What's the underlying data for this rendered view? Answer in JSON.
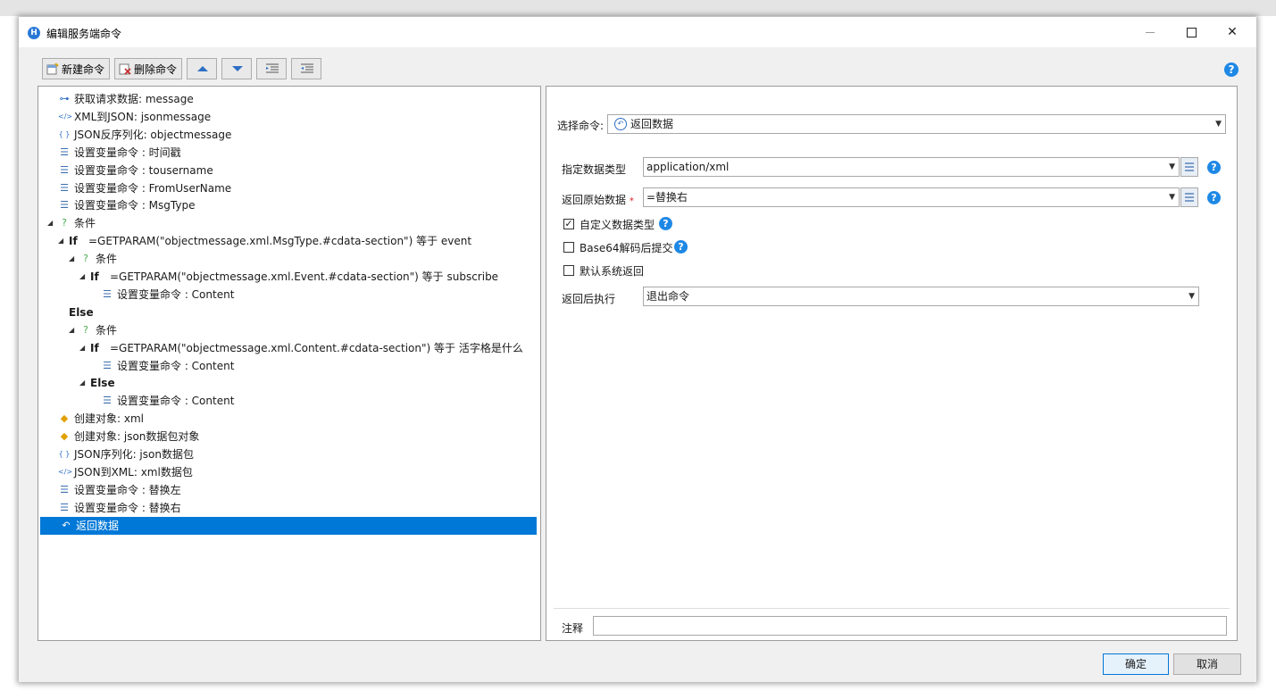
{
  "window": {
    "title": "编辑服务端命令",
    "app_icon": "H"
  },
  "toolbar": {
    "new_cmd": "新建命令",
    "delete_cmd": "删除命令"
  },
  "tree": [
    {
      "indent": 0,
      "icon": "request",
      "label": "获取请求数据: message"
    },
    {
      "indent": 0,
      "icon": "xml",
      "label": "XML到JSON: jsonmessage"
    },
    {
      "indent": 0,
      "icon": "json",
      "label": "JSON反序列化: objectmessage"
    },
    {
      "indent": 0,
      "icon": "setvar",
      "label": "设置变量命令 : 时间戳"
    },
    {
      "indent": 0,
      "icon": "setvar",
      "label": "设置变量命令 : tousername"
    },
    {
      "indent": 0,
      "icon": "setvar",
      "label": "设置变量命令 : FromUserName"
    },
    {
      "indent": 0,
      "icon": "setvar",
      "label": "设置变量命令 : MsgType"
    },
    {
      "indent": 0,
      "icon": "cond",
      "expander": true,
      "label": "条件"
    },
    {
      "indent": 1,
      "icon": "",
      "expander": true,
      "bold": "If",
      "label": "=GETPARAM(\"objectmessage.xml.MsgType.#cdata-section\") 等于 event"
    },
    {
      "indent": 2,
      "icon": "cond",
      "expander": true,
      "label": "条件"
    },
    {
      "indent": 3,
      "icon": "",
      "expander": true,
      "bold": "If",
      "label": "=GETPARAM(\"objectmessage.xml.Event.#cdata-section\") 等于 subscribe"
    },
    {
      "indent": 4,
      "icon": "setvar",
      "label": "设置变量命令 : Content"
    },
    {
      "indent": 1,
      "icon": "",
      "bold": "Else",
      "label": ""
    },
    {
      "indent": 2,
      "icon": "cond",
      "expander": true,
      "label": "条件"
    },
    {
      "indent": 3,
      "icon": "",
      "expander": true,
      "bold": "If",
      "label": "=GETPARAM(\"objectmessage.xml.Content.#cdata-section\") 等于 活字格是什么"
    },
    {
      "indent": 4,
      "icon": "setvar",
      "label": "设置变量命令 : Content"
    },
    {
      "indent": 3,
      "icon": "",
      "expander": true,
      "bold": "Else",
      "label": ""
    },
    {
      "indent": 4,
      "icon": "setvar",
      "label": "设置变量命令 : Content"
    },
    {
      "indent": 0,
      "icon": "create",
      "label": "创建对象:  xml"
    },
    {
      "indent": 0,
      "icon": "create",
      "label": "创建对象:  json数据包对象"
    },
    {
      "indent": 0,
      "icon": "json",
      "label": "JSON序列化: json数据包"
    },
    {
      "indent": 0,
      "icon": "xml",
      "label": "JSON到XML: xml数据包"
    },
    {
      "indent": 0,
      "icon": "setvar",
      "label": "设置变量命令 : 替换左"
    },
    {
      "indent": 0,
      "icon": "setvar",
      "label": "设置变量命令 : 替换右"
    },
    {
      "indent": 0,
      "icon": "return",
      "label": "返回数据",
      "selected": true
    }
  ],
  "form": {
    "select_cmd_label": "选择命令:",
    "select_cmd_value": "返回数据",
    "data_type_label": "指定数据类型",
    "data_type_value": "application/xml",
    "raw_data_label": "返回原始数据",
    "raw_data_required": "*",
    "raw_data_value": "=替换右",
    "custom_type_label": "自定义数据类型",
    "custom_type_checked": true,
    "base64_label": "Base64解码后提交",
    "base64_checked": false,
    "default_return_label": "默认系统返回",
    "default_return_checked": false,
    "after_return_label": "返回后执行",
    "after_return_value": "退出命令",
    "note_label": "注释",
    "note_value": ""
  },
  "buttons": {
    "ok": "确定",
    "cancel": "取消"
  },
  "colors": {
    "selection": "#0078d7",
    "help": "#1e88e5",
    "accent": "#0078d7"
  }
}
